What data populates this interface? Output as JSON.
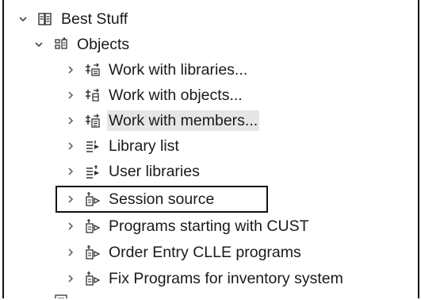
{
  "tree": {
    "root": {
      "label": "Best Stuff",
      "icon": "project-icon"
    },
    "objects": {
      "label": "Objects",
      "icon": "object-filter-pool-icon"
    },
    "items": [
      {
        "label": "Work with libraries...",
        "icon": "work-with-libraries-icon"
      },
      {
        "label": "Work with objects...",
        "icon": "work-with-objects-icon"
      },
      {
        "label": "Work with members...",
        "icon": "work-with-members-icon",
        "highlighted": true
      },
      {
        "label": "Library list",
        "icon": "library-list-icon"
      },
      {
        "label": "User libraries",
        "icon": "user-libraries-icon"
      },
      {
        "label": "Session source",
        "icon": "filter-icon",
        "outlined": true
      },
      {
        "label": "Programs starting with CUST",
        "icon": "filter-icon"
      },
      {
        "label": "Order Entry CLLE programs",
        "icon": "filter-icon"
      },
      {
        "label": "Fix Programs for inventory system",
        "icon": "filter-icon"
      }
    ]
  }
}
